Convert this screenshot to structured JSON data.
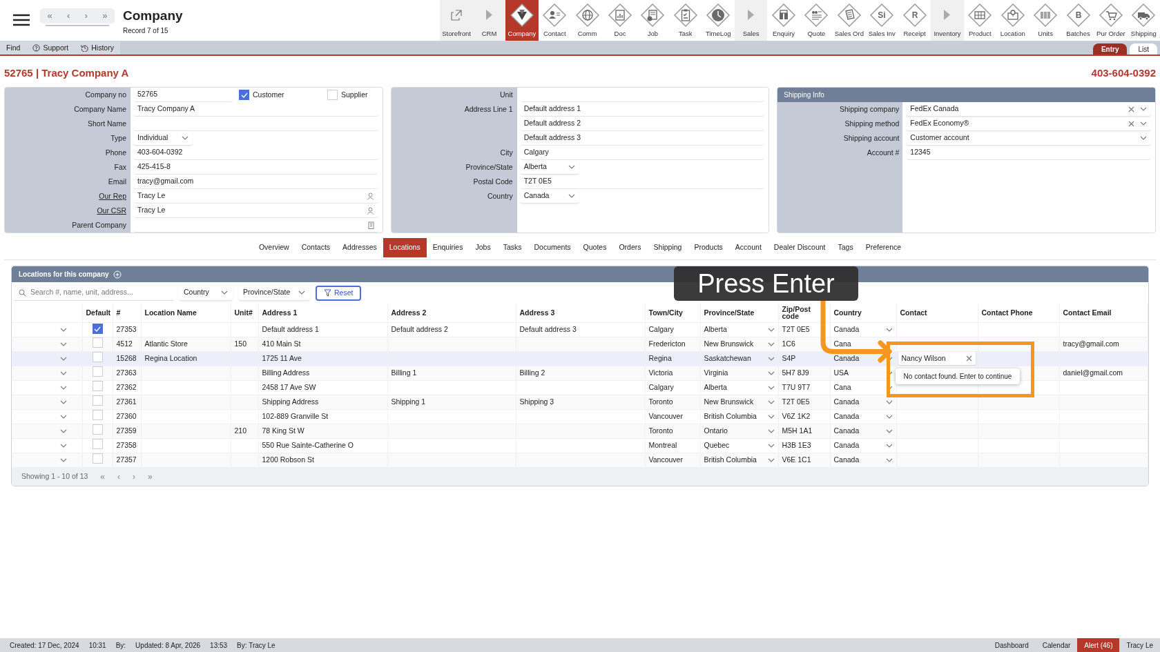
{
  "header": {
    "title": "Company",
    "subtitle": "Record 7 of 15",
    "pager": [
      "«",
      "‹",
      "›",
      "»"
    ]
  },
  "modules": [
    {
      "label": "Storefront",
      "kind": "link",
      "selected": false
    },
    {
      "label": "CRM",
      "kind": "section",
      "selected": false
    },
    {
      "label": "Company",
      "kind": "module",
      "selected": true
    },
    {
      "label": "Contact",
      "kind": "module",
      "selected": false
    },
    {
      "label": "Comm",
      "kind": "module",
      "selected": false
    },
    {
      "label": "Doc",
      "kind": "module",
      "selected": false
    },
    {
      "label": "Job",
      "kind": "module",
      "selected": false
    },
    {
      "label": "Task",
      "kind": "module",
      "selected": false
    },
    {
      "label": "TimeLog",
      "kind": "module",
      "selected": false
    },
    {
      "label": "Sales",
      "kind": "section",
      "selected": false
    },
    {
      "label": "Enquiry",
      "kind": "module",
      "selected": false
    },
    {
      "label": "Quote",
      "kind": "module",
      "selected": false
    },
    {
      "label": "Sales Ord",
      "kind": "module",
      "selected": false
    },
    {
      "label": "Sales Inv",
      "kind": "module",
      "glyph": "Si",
      "selected": false
    },
    {
      "label": "Receipt",
      "kind": "module",
      "glyph": "R",
      "selected": false
    },
    {
      "label": "Inventory",
      "kind": "section",
      "selected": false
    },
    {
      "label": "Product",
      "kind": "module",
      "selected": false
    },
    {
      "label": "Location",
      "kind": "module",
      "selected": false
    },
    {
      "label": "Units",
      "kind": "module",
      "selected": false
    },
    {
      "label": "Batches",
      "kind": "module",
      "glyph": "B",
      "selected": false
    },
    {
      "label": "Pur Order",
      "kind": "module",
      "selected": false
    },
    {
      "label": "Shipping",
      "kind": "module",
      "selected": false
    }
  ],
  "toolbar": [
    {
      "label": "Find",
      "kind": "plain"
    },
    {
      "label": "Support",
      "kind": "help"
    },
    {
      "label": "History",
      "kind": "history"
    }
  ],
  "view_tabs": [
    {
      "label": "Entry",
      "selected": true
    },
    {
      "label": "List",
      "selected": false
    }
  ],
  "record": {
    "title": "52765 | Tracy Company A",
    "phone": "403-604-0392"
  },
  "company_panel": {
    "fields": [
      {
        "kind": "text",
        "label": "Company no",
        "value": "52765",
        "checks": [
          {
            "label": "Customer",
            "checked": true
          },
          {
            "label": "Supplier",
            "checked": false
          }
        ]
      },
      {
        "kind": "text",
        "label": "Company Name",
        "value": "Tracy Company A"
      },
      {
        "kind": "text",
        "label": "Short Name"
      },
      {
        "kind": "select",
        "label": "Type",
        "value": "Individual"
      },
      {
        "kind": "text",
        "label": "Phone",
        "value": "403-604-0392"
      },
      {
        "kind": "text",
        "label": "Fax",
        "value": "425-415-8"
      },
      {
        "kind": "text",
        "label": "Email",
        "value": "tracy@gmail.com"
      },
      {
        "kind": "person",
        "label": "Our Rep",
        "link": true,
        "value": "Tracy Le"
      },
      {
        "kind": "person",
        "label": "Our CSR",
        "link": true,
        "value": "Tracy Le"
      },
      {
        "kind": "building",
        "label": "Parent Company"
      }
    ]
  },
  "address_panel": {
    "fields": [
      {
        "kind": "text",
        "label": "Unit"
      },
      {
        "kind": "text",
        "label": "Address Line 1",
        "value": "Default address 1"
      },
      {
        "kind": "text",
        "value": "Default address 2"
      },
      {
        "kind": "text",
        "value": "Default address 3"
      },
      {
        "kind": "text",
        "label": "City",
        "value": "Calgary"
      },
      {
        "kind": "select",
        "label": "Province/State",
        "value": "Alberta"
      },
      {
        "kind": "text",
        "label": "Postal Code",
        "value": "T2T 0E5"
      },
      {
        "kind": "select",
        "label": "Country",
        "value": "Canada"
      }
    ]
  },
  "shipping_panel": {
    "title": "Shipping Info",
    "fields": [
      {
        "kind": "combo",
        "label": "Shipping company",
        "value": "FedEx Canada"
      },
      {
        "kind": "combo",
        "label": "Shipping method",
        "value": "FedEx Economy®"
      },
      {
        "kind": "wideselect",
        "label": "Shipping account",
        "value": "Customer account"
      },
      {
        "kind": "text",
        "label": "Account #",
        "value": "12345"
      }
    ]
  },
  "tabs": [
    {
      "label": "Overview",
      "selected": false
    },
    {
      "label": "Contacts",
      "selected": false
    },
    {
      "label": "Addresses",
      "selected": false
    },
    {
      "label": "Locations",
      "selected": true
    },
    {
      "label": "Enquiries",
      "selected": false
    },
    {
      "label": "Jobs",
      "selected": false
    },
    {
      "label": "Tasks",
      "selected": false
    },
    {
      "label": "Documents",
      "selected": false
    },
    {
      "label": "Quotes",
      "selected": false
    },
    {
      "label": "Orders",
      "selected": false
    },
    {
      "label": "Shipping",
      "selected": false
    },
    {
      "label": "Products",
      "selected": false
    },
    {
      "label": "Account",
      "selected": false
    },
    {
      "label": "Dealer Discount",
      "selected": false
    },
    {
      "label": "Tags",
      "selected": false
    },
    {
      "label": "Preference",
      "selected": false
    }
  ],
  "locations": {
    "title": "Locations for this company",
    "search": {
      "placeholder": "Search #, name, unit, address..."
    },
    "filters": [
      "Country",
      "Province/State"
    ],
    "reset": "Reset",
    "columns": [
      {
        "label": "Default",
        "kind": "check"
      },
      {
        "label": "#",
        "kind": "text"
      },
      {
        "label": "Location Name",
        "kind": "text"
      },
      {
        "label": "Unit#",
        "kind": "text"
      },
      {
        "label": "Address 1",
        "kind": "text"
      },
      {
        "label": "Address 2",
        "kind": "text"
      },
      {
        "label": "Address 3",
        "kind": "text"
      },
      {
        "label": "Town/City",
        "kind": "text"
      },
      {
        "label": "Province/State",
        "kind": "select"
      },
      {
        "label": "Zip/Post code",
        "kind": "text"
      },
      {
        "label": "Country",
        "kind": "select"
      },
      {
        "label": "Contact",
        "kind": "contact"
      },
      {
        "label": "Contact Phone",
        "kind": "text"
      },
      {
        "label": "Contact Email",
        "kind": "text"
      }
    ],
    "rows": [
      {
        "default": true,
        "selected": false,
        "number": "27353",
        "address_1": "Default address 1",
        "address_2": "Default address 2",
        "address_3": "Default address 3",
        "town_city": "Calgary",
        "province_state": "Alberta",
        "zip": "T2T 0E5",
        "country": "Canada"
      },
      {
        "default": false,
        "selected": false,
        "number": "4512",
        "location_name": "Atlantic Store",
        "unit": "150",
        "address_1": "410 Main St",
        "town_city": "Fredericton",
        "province_state": "New Brunswick",
        "zip": "1C6",
        "country": "Cana",
        "contact_email": "tracy@gmail.com"
      },
      {
        "default": false,
        "selected": true,
        "number": "15268",
        "location_name": "Regina Location",
        "address_1": "1725 11 Ave",
        "town_city": "Regina",
        "province_state": "Saskatchewan",
        "zip": "S4P",
        "country": "Canada",
        "contact": {
          "kind": "input",
          "value": "Nancy Wilson"
        }
      },
      {
        "default": false,
        "selected": false,
        "number": "27363",
        "address_1": "Billing Address",
        "address_2": "Billing 1",
        "address_3": "Billing 2",
        "town_city": "Victoria",
        "province_state": "Virginia",
        "zip": "5H7 8J9",
        "country": "USA",
        "contact_email": "daniel@gmail.com"
      },
      {
        "default": false,
        "selected": false,
        "number": "27362",
        "address_1": "2458 17 Ave SW",
        "town_city": "Calgary",
        "province_state": "Alberta",
        "zip": "T7U 9T7",
        "country": "Cana"
      },
      {
        "default": false,
        "selected": false,
        "number": "27361",
        "address_1": "Shipping Address",
        "address_2": "Shipping 1",
        "address_3": "Shipping 3",
        "town_city": "Toronto",
        "province_state": "New Brunswick",
        "zip": "T2T 0E5",
        "country": "Canada"
      },
      {
        "default": false,
        "selected": false,
        "number": "27360",
        "address_1": "102-889 Granville St",
        "town_city": "Vancouver",
        "province_state": "British Columbia",
        "zip": "V6Z 1K2",
        "country": "Canada"
      },
      {
        "default": false,
        "selected": false,
        "number": "27359",
        "unit": "210",
        "address_1": "78 King St W",
        "town_city": "Toronto",
        "province_state": "Ontario",
        "zip": "M5H 1A1",
        "country": "Canada"
      },
      {
        "default": false,
        "selected": false,
        "number": "27358",
        "address_1": "550 Rue Sainte-Catherine O",
        "town_city": "Montreal",
        "province_state": "Quebec",
        "zip": "H3B 1E3",
        "country": "Canada"
      },
      {
        "default": false,
        "selected": false,
        "number": "27357",
        "address_1": "1200 Robson St",
        "town_city": "Vancouver",
        "province_state": "British Columbia",
        "zip": "V6E 1C1",
        "country": "Canada"
      }
    ],
    "footer": "Showing 1 - 10 of 13",
    "pager": [
      "«",
      "‹",
      "›",
      "»"
    ]
  },
  "popup": {
    "text": "No contact found. Enter to continue"
  },
  "annotation": {
    "text": "Press Enter"
  },
  "status_bar": {
    "left": [
      "Created: 17 Dec, 2024",
      "10:31",
      "By:",
      "Updated: 8 Apr, 2026",
      "13:53",
      "By: Tracy Le"
    ],
    "right": [
      {
        "label": "Dashboard",
        "alert": false
      },
      {
        "label": "Calendar",
        "alert": false
      },
      {
        "label": "Alert (46)",
        "alert": true
      },
      {
        "label": "Tracy Le",
        "alert": false
      }
    ]
  }
}
